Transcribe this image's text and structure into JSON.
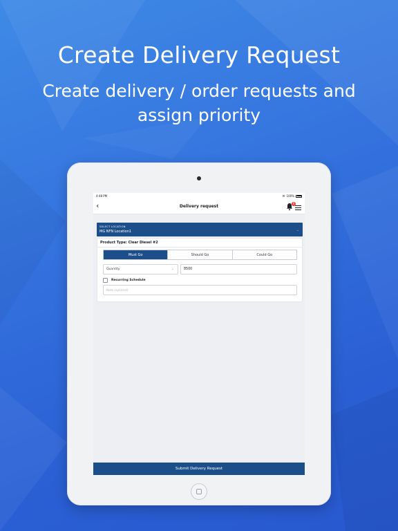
{
  "marketing": {
    "headline": "Create Delivery Request",
    "subline": "Create delivery / order requests and assign priority"
  },
  "colors": {
    "accent": "#1c4f8a",
    "background": "#3472de",
    "badge": "#e53935"
  },
  "status_bar": {
    "time": "4:48 PM",
    "battery": "100%"
  },
  "nav": {
    "back_icon": "chevron-left-icon",
    "title": "Delivery request",
    "notification_count": "0",
    "bell_icon": "bell-icon",
    "menu_icon": "hamburger-menu-icon"
  },
  "location": {
    "label": "SELECT LOCATION",
    "value": "MG NFN Location1"
  },
  "order": {
    "product_type": "Product Type: Clear Diesel #2",
    "priority_options": [
      "Must Go",
      "Should Go",
      "Could Go"
    ],
    "selected_priority": "Must Go",
    "unit_select": "Quantity",
    "quantity_value": "8500",
    "recurring_label": "Recurring Schedule",
    "note_placeholder": "Note (optional)"
  },
  "submit_label": "Submit Delivery Request"
}
